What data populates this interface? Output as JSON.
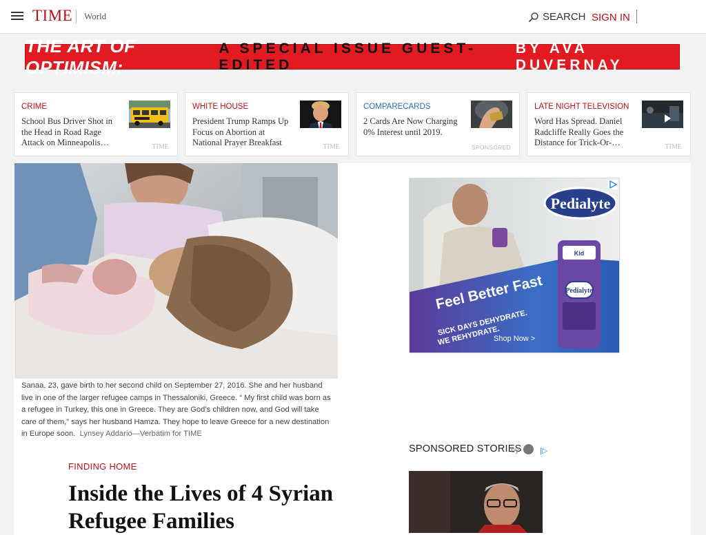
{
  "header": {
    "logo": "TIME",
    "section": "World",
    "search_label": "SEARCH",
    "signin_label": "SIGN IN"
  },
  "banner": {
    "part1": "THE ART OF OPTIMISM:",
    "part2": "A SPECIAL ISSUE GUEST-EDITED",
    "part3": "BY AVA DUVERNAY"
  },
  "cards": [
    {
      "category": "CRIME",
      "category_color": "#b7111b",
      "title": "School Bus Driver Shot in the Head in Road Rage Attack on Minneapolis…",
      "source": "TIME"
    },
    {
      "category": "WHITE HOUSE",
      "category_color": "#b7111b",
      "title": "President Trump Ramps Up Focus on Abortion at National Prayer Breakfast",
      "source": "TIME"
    },
    {
      "category": "COMPARECARDS",
      "category_color": "#2a6db0",
      "title": "2 Cards Are Now Charging 0% Interest until 2019.",
      "source": "SPONSORED"
    },
    {
      "category": "LATE NIGHT TELEVISION",
      "category_color": "#b7111b",
      "title": "Word Has Spread. Daniel Radcliffe Really Goes the Distance for Trick-Or-…",
      "source": "TIME"
    }
  ],
  "article": {
    "caption": "Sanaa, 23, gave birth to her second child on September 27, 2016. She and her husband live in one of the larger refugee camps in Thessaloniki, Greece. “ My first child was born as a refugee in Turkey, this one in Greece. They are God’s children now, and God will take care of them,” says her husband Hamza. They hope to leave Greece for a new destination in Europe soon.",
    "credit": "Lynsey Addario—Verbatim for TIME",
    "kicker": "FINDING HOME",
    "headline": "Inside the Lives of 4 Syrian Refugee Families"
  },
  "ad": {
    "brand": "Pedialyte",
    "tagline": "Feel Better Fast",
    "line1": "SICK DAYS DEHYDRATE.",
    "line2": "WE REHYDRATE.",
    "cta": "Shop Now >",
    "bottle_small": "Kid",
    "bottle_label": "Pedialyte"
  },
  "sponsored": {
    "title": "SPONSORED STORIES",
    "by": "by",
    "choice": "|▷"
  },
  "colors": {
    "brand_red": "#b7111b",
    "banner_red": "#e21b23",
    "sponsor_blue": "#2a6db0"
  }
}
